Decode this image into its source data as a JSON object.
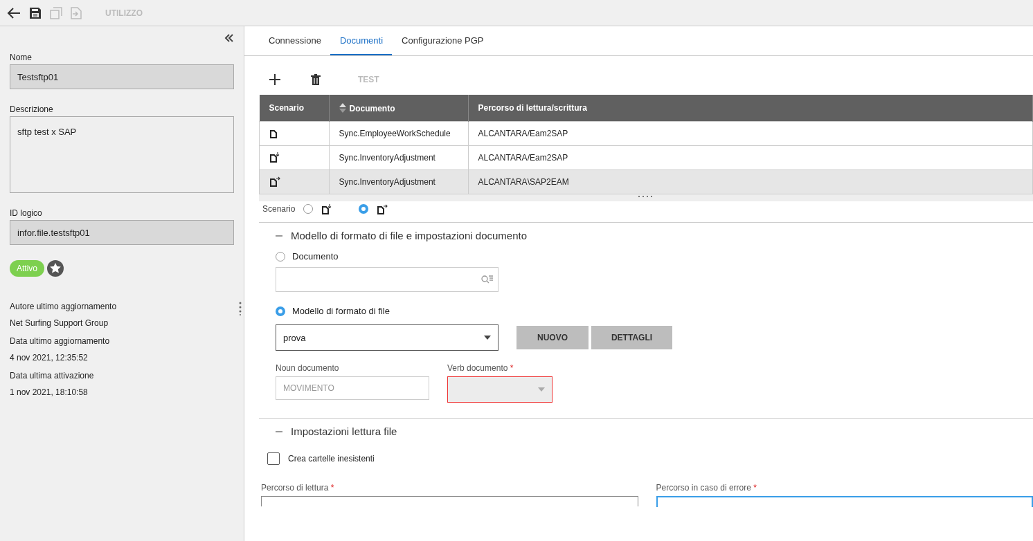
{
  "toolbar": {
    "actions": [
      {
        "kind": "back",
        "disabled": false
      },
      {
        "kind": "save",
        "disabled": false
      },
      {
        "kind": "copy",
        "disabled": true
      },
      {
        "kind": "import",
        "disabled": true
      }
    ],
    "usage_label": "UTILIZZO"
  },
  "sidebar": {
    "fields": [
      {
        "label": "Nome",
        "value": "Testsftp01",
        "multiline": false
      },
      {
        "label": "Descrizione",
        "value": "sftp test x SAP",
        "multiline": true
      },
      {
        "label": "ID logico",
        "value": "infor.file.testsftp01",
        "multiline": false
      }
    ],
    "status_badge": "Attivo",
    "favorite": true,
    "meta": [
      {
        "label": "Autore ultimo aggiornamento",
        "value": "Net Surfing Support Group"
      },
      {
        "label": "Data ultimo aggiornamento",
        "value": "4 nov 2021, 12:35:52"
      },
      {
        "label": "Data ultima attivazione",
        "value": "1 nov 2021, 18:10:58"
      }
    ]
  },
  "tabs": [
    {
      "label": "Connessione",
      "selected": false
    },
    {
      "label": "Documenti",
      "selected": true
    },
    {
      "label": "Configurazione PGP",
      "selected": false
    }
  ],
  "table_toolbar": {
    "test_label": "TEST"
  },
  "table": {
    "columns": [
      "Scenario",
      "Documento",
      "Percorso di lettura/scrittura"
    ],
    "rows": [
      {
        "kind": "plain",
        "documento": "Sync.EmployeeWorkSchedule",
        "percorso": "ALCANTARA/Eam2SAP",
        "selected": false
      },
      {
        "kind": "in",
        "documento": "Sync.InventoryAdjustment",
        "percorso": "ALCANTARA/Eam2SAP",
        "selected": false
      },
      {
        "kind": "out",
        "documento": "Sync.InventoryAdjustment",
        "percorso": "ALCANTARA\\SAP2EAM",
        "selected": true
      }
    ]
  },
  "scenario": {
    "label": "Scenario",
    "options": [
      {
        "kind": "in",
        "selected": false
      },
      {
        "kind": "out",
        "selected": true
      }
    ]
  },
  "format_section": {
    "title": "Modello di formato di file e impostazioni documento",
    "expanded": true,
    "document_option": {
      "label": "Documento",
      "selected": false
    },
    "template_option": {
      "label": "Modello di formato di file",
      "selected": true
    },
    "template_value": "prova",
    "buttons": [
      "NUOVO",
      "DETTAGLI"
    ],
    "noun": {
      "label": "Noun documento",
      "value": "MOVIMENTO",
      "disabled": true
    },
    "verb": {
      "label": "Verb documento",
      "required_mark": "*",
      "error": true
    }
  },
  "read_section": {
    "title": "Impostazioni lettura file",
    "expanded": true,
    "create_folders": {
      "label": "Crea cartelle inesistenti",
      "checked": false
    },
    "paths": [
      {
        "label": "Percorso di lettura",
        "required_mark": "*",
        "focused": false
      },
      {
        "label": "Percorso in caso di errore",
        "required_mark": "*",
        "focused": true
      }
    ]
  }
}
